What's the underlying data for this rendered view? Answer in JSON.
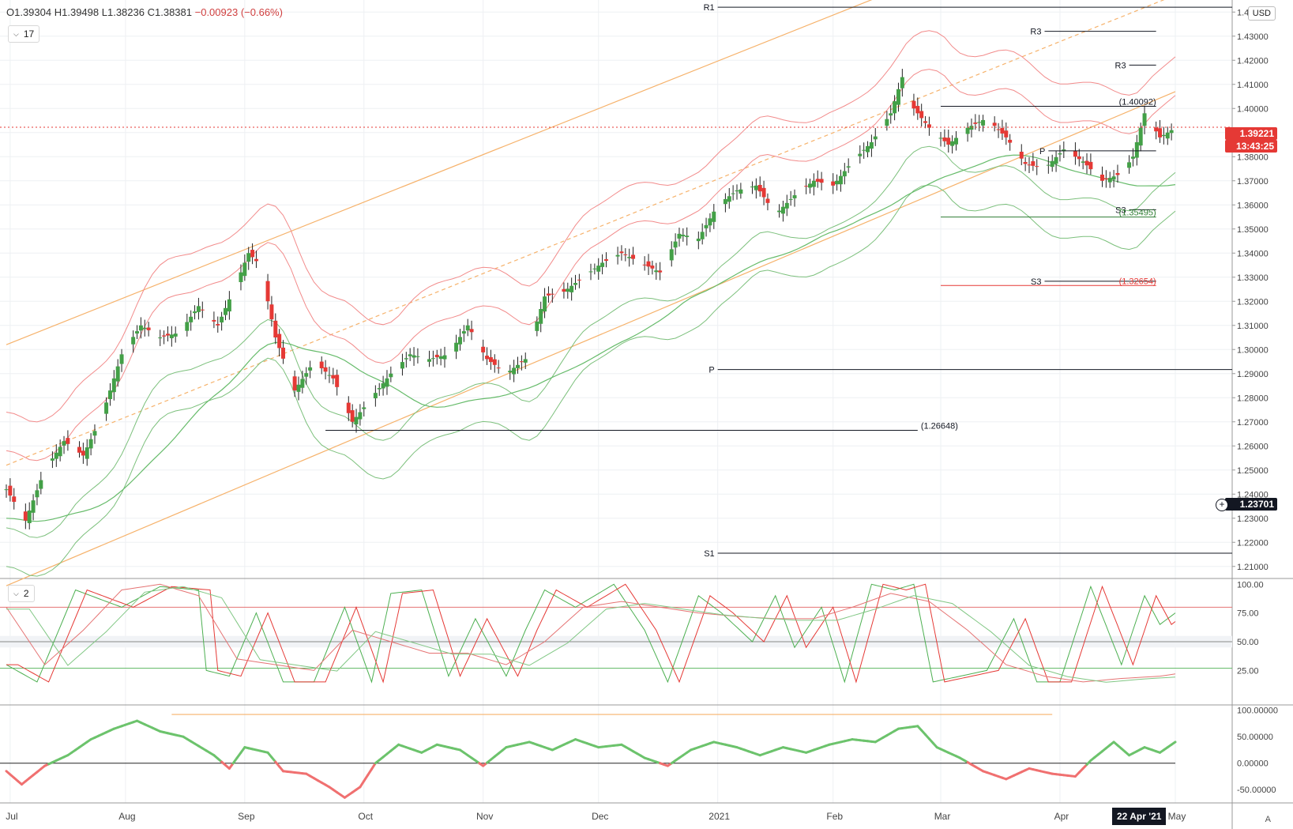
{
  "header": {
    "open": "O1.39304",
    "high": "H1.39498",
    "low": "L1.38236",
    "close": "C1.38381",
    "change": "−0.00923 (−0.66%)",
    "pane1_control": "17",
    "pane2_control": "2",
    "currency": "USD"
  },
  "tags": {
    "last_price": "1.39221",
    "countdown": "13:43:25",
    "crosshair_price": "1.23701",
    "crosshair_date": "22 Apr '21"
  },
  "colors": {
    "up": "#43a047",
    "down": "#e53935",
    "bb": "#f28b8b",
    "bb_green": "#7cc07c",
    "ma": "#66bb6a",
    "channel": "#f6b26b",
    "levels": "#131722",
    "axis_text": "#444",
    "grid": "#eef0f3"
  },
  "axis": {
    "x_labels": [
      {
        "t": 1,
        "label": "Jul"
      },
      {
        "t": 31,
        "label": "Aug"
      },
      {
        "t": 62,
        "label": "Sep"
      },
      {
        "t": 93,
        "label": "Oct"
      },
      {
        "t": 124,
        "label": "Nov"
      },
      {
        "t": 154,
        "label": "Dec"
      },
      {
        "t": 185,
        "label": "2021"
      },
      {
        "t": 215,
        "label": "Feb"
      },
      {
        "t": 243,
        "label": "Mar"
      },
      {
        "t": 274,
        "label": "Apr"
      },
      {
        "t": 304,
        "label": "May"
      }
    ],
    "price_ticks": [
      "1.44000",
      "1.43000",
      "1.42000",
      "1.41000",
      "1.40000",
      "1.39000",
      "1.38000",
      "1.37000",
      "1.36000",
      "1.35000",
      "1.34000",
      "1.33000",
      "1.32000",
      "1.31000",
      "1.30000",
      "1.29000",
      "1.28000",
      "1.27000",
      "1.26000",
      "1.25000",
      "1.24000",
      "1.23000",
      "1.22000",
      "1.21000"
    ],
    "stoch_ticks": [
      "100.00",
      "75.00",
      "50.00",
      "25.00"
    ],
    "osc_ticks": [
      "100.00000",
      "50.00000",
      "0.00000",
      "-50.00000"
    ]
  },
  "chart_data": [
    {
      "type": "candlestick",
      "x_unit": "calendar days from 1 Jul 2020",
      "price_range": [
        1.205,
        1.445
      ],
      "closes_by_day": [
        [
          0,
          1.242
        ],
        [
          5,
          1.229
        ],
        [
          10,
          1.25
        ],
        [
          15,
          1.262
        ],
        [
          20,
          1.256
        ],
        [
          25,
          1.273
        ],
        [
          30,
          1.298
        ],
        [
          35,
          1.31
        ],
        [
          40,
          1.305
        ],
        [
          45,
          1.307
        ],
        [
          50,
          1.318
        ],
        [
          55,
          1.31
        ],
        [
          60,
          1.328
        ],
        [
          63,
          1.34
        ],
        [
          66,
          1.335
        ],
        [
          70,
          1.305
        ],
        [
          75,
          1.283
        ],
        [
          80,
          1.295
        ],
        [
          85,
          1.288
        ],
        [
          90,
          1.27
        ],
        [
          95,
          1.28
        ],
        [
          100,
          1.29
        ],
        [
          105,
          1.298
        ],
        [
          110,
          1.296
        ],
        [
          115,
          1.298
        ],
        [
          120,
          1.31
        ],
        [
          125,
          1.296
        ],
        [
          130,
          1.29
        ],
        [
          135,
          1.296
        ],
        [
          140,
          1.322
        ],
        [
          145,
          1.324
        ],
        [
          150,
          1.33
        ],
        [
          155,
          1.336
        ],
        [
          160,
          1.34
        ],
        [
          165,
          1.336
        ],
        [
          170,
          1.332
        ],
        [
          175,
          1.348
        ],
        [
          180,
          1.346
        ],
        [
          185,
          1.36
        ],
        [
          190,
          1.366
        ],
        [
          195,
          1.368
        ],
        [
          200,
          1.356
        ],
        [
          205,
          1.364
        ],
        [
          210,
          1.37
        ],
        [
          215,
          1.368
        ],
        [
          220,
          1.378
        ],
        [
          225,
          1.386
        ],
        [
          230,
          1.398
        ],
        [
          233,
          1.413
        ],
        [
          236,
          1.4
        ],
        [
          240,
          1.392
        ],
        [
          245,
          1.385
        ],
        [
          250,
          1.392
        ],
        [
          255,
          1.396
        ],
        [
          260,
          1.388
        ],
        [
          265,
          1.377
        ],
        [
          270,
          1.375
        ],
        [
          275,
          1.383
        ],
        [
          280,
          1.378
        ],
        [
          285,
          1.37
        ],
        [
          290,
          1.373
        ],
        [
          293,
          1.38
        ],
        [
          296,
          1.398
        ],
        [
          300,
          1.388
        ],
        [
          304,
          1.392
        ]
      ],
      "levels": [
        {
          "label": "R1",
          "price": 1.442
        },
        {
          "label": "R3",
          "price": 1.432
        },
        {
          "label": "R3",
          "price": 1.418
        },
        {
          "label": "(1.40092)",
          "price": 1.40092
        },
        {
          "label": "P",
          "price": 1.3824
        },
        {
          "label": "S3",
          "price": 1.358
        },
        {
          "label": "(1.35495)",
          "price": 1.35495
        },
        {
          "label": "S3",
          "price": 1.3283
        },
        {
          "label": "(1.32654)",
          "price": 1.32654
        },
        {
          "label": "P",
          "price": 1.2917
        },
        {
          "label": "(1.26648)",
          "price": 1.26648
        },
        {
          "label": "S1",
          "price": 1.2155
        }
      ]
    },
    {
      "type": "line",
      "name_hint": "stochastic pane",
      "y_range": [
        0,
        100
      ],
      "guides": [
        80,
        50,
        27
      ],
      "fast_by_day": [
        [
          0,
          30
        ],
        [
          8,
          15
        ],
        [
          18,
          95
        ],
        [
          30,
          80
        ],
        [
          40,
          98
        ],
        [
          50,
          95
        ],
        [
          52,
          25
        ],
        [
          58,
          20
        ],
        [
          65,
          75
        ],
        [
          72,
          15
        ],
        [
          80,
          15
        ],
        [
          88,
          80
        ],
        [
          95,
          15
        ],
        [
          100,
          92
        ],
        [
          108,
          95
        ],
        [
          115,
          20
        ],
        [
          122,
          70
        ],
        [
          130,
          20
        ],
        [
          135,
          60
        ],
        [
          140,
          95
        ],
        [
          148,
          80
        ],
        [
          158,
          100
        ],
        [
          166,
          60
        ],
        [
          172,
          15
        ],
        [
          180,
          90
        ],
        [
          186,
          75
        ],
        [
          194,
          50
        ],
        [
          200,
          90
        ],
        [
          205,
          45
        ],
        [
          212,
          80
        ],
        [
          218,
          15
        ],
        [
          225,
          100
        ],
        [
          231,
          95
        ],
        [
          236,
          100
        ],
        [
          241,
          15
        ],
        [
          248,
          20
        ],
        [
          255,
          25
        ],
        [
          262,
          70
        ],
        [
          268,
          15
        ],
        [
          274,
          15
        ],
        [
          282,
          98
        ],
        [
          290,
          30
        ],
        [
          296,
          90
        ],
        [
          300,
          65
        ],
        [
          304,
          75
        ]
      ],
      "slow_by_day": [
        [
          0,
          80
        ],
        [
          10,
          30
        ],
        [
          20,
          60
        ],
        [
          30,
          95
        ],
        [
          40,
          100
        ],
        [
          50,
          90
        ],
        [
          60,
          35
        ],
        [
          70,
          30
        ],
        [
          80,
          25
        ],
        [
          90,
          60
        ],
        [
          100,
          50
        ],
        [
          110,
          40
        ],
        [
          120,
          40
        ],
        [
          130,
          30
        ],
        [
          140,
          50
        ],
        [
          150,
          80
        ],
        [
          160,
          85
        ],
        [
          170,
          80
        ],
        [
          180,
          75
        ],
        [
          190,
          72
        ],
        [
          200,
          70
        ],
        [
          210,
          70
        ],
        [
          220,
          80
        ],
        [
          230,
          92
        ],
        [
          240,
          85
        ],
        [
          250,
          60
        ],
        [
          260,
          30
        ],
        [
          270,
          20
        ],
        [
          280,
          15
        ],
        [
          290,
          18
        ],
        [
          300,
          20
        ],
        [
          304,
          22
        ]
      ]
    },
    {
      "type": "line",
      "name_hint": "oscillator pane",
      "y_range": [
        -75,
        110
      ],
      "guides": [
        0
      ],
      "values_by_day": [
        [
          0,
          -15
        ],
        [
          4,
          -40
        ],
        [
          10,
          -5
        ],
        [
          16,
          15
        ],
        [
          22,
          45
        ],
        [
          28,
          65
        ],
        [
          34,
          80
        ],
        [
          40,
          60
        ],
        [
          46,
          50
        ],
        [
          54,
          15
        ],
        [
          58,
          -10
        ],
        [
          62,
          30
        ],
        [
          68,
          20
        ],
        [
          72,
          -15
        ],
        [
          78,
          -20
        ],
        [
          84,
          -45
        ],
        [
          88,
          -65
        ],
        [
          92,
          -45
        ],
        [
          96,
          0
        ],
        [
          102,
          35
        ],
        [
          108,
          20
        ],
        [
          112,
          35
        ],
        [
          118,
          25
        ],
        [
          124,
          -5
        ],
        [
          130,
          30
        ],
        [
          136,
          40
        ],
        [
          142,
          25
        ],
        [
          148,
          45
        ],
        [
          154,
          30
        ],
        [
          160,
          35
        ],
        [
          166,
          10
        ],
        [
          172,
          -5
        ],
        [
          178,
          25
        ],
        [
          184,
          40
        ],
        [
          190,
          30
        ],
        [
          196,
          15
        ],
        [
          202,
          30
        ],
        [
          208,
          20
        ],
        [
          214,
          35
        ],
        [
          220,
          45
        ],
        [
          226,
          40
        ],
        [
          232,
          65
        ],
        [
          237,
          70
        ],
        [
          242,
          30
        ],
        [
          248,
          10
        ],
        [
          254,
          -15
        ],
        [
          260,
          -30
        ],
        [
          266,
          -10
        ],
        [
          272,
          -20
        ],
        [
          278,
          -25
        ],
        [
          282,
          5
        ],
        [
          288,
          40
        ],
        [
          292,
          15
        ],
        [
          296,
          30
        ],
        [
          300,
          20
        ],
        [
          304,
          40
        ]
      ],
      "resistance_line": {
        "t0": 43,
        "t1": 272,
        "value": 92
      }
    }
  ]
}
